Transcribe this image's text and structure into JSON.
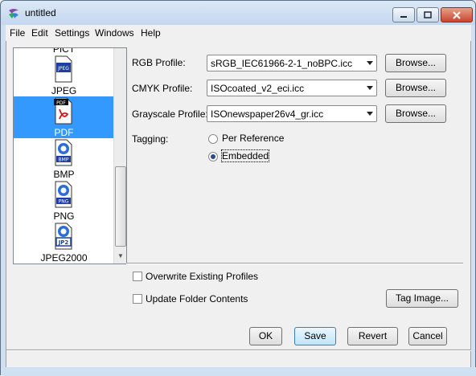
{
  "window": {
    "title": "untitled"
  },
  "menubar": {
    "items": [
      "File",
      "Edit",
      "Settings",
      "Windows",
      "Help"
    ]
  },
  "format_list": {
    "partial_top_label": "PICT",
    "items": [
      {
        "label": "JPEG",
        "icon_text": "JPEG",
        "icon": "jpeg-file-icon",
        "selected": false
      },
      {
        "label": "PDF",
        "icon_text": "PDF",
        "icon": "pdf-file-icon",
        "selected": true
      },
      {
        "label": "BMP",
        "icon_text": "BMP",
        "icon": "bmp-file-icon",
        "selected": false
      },
      {
        "label": "PNG",
        "icon_text": "PNG",
        "icon": "png-file-icon",
        "selected": false
      },
      {
        "label": "JPEG2000",
        "icon_text": "JP2",
        "icon": "jp2-file-icon",
        "selected": false
      }
    ]
  },
  "profiles": {
    "rgb_label": "RGB Profile:",
    "rgb_value": "sRGB_IEC61966-2-1_noBPC.icc",
    "cmyk_label": "CMYK Profile:",
    "cmyk_value": "ISOcoated_v2_eci.icc",
    "gray_label": "Grayscale Profile:",
    "gray_value": "ISOnewspaper26v4_gr.icc",
    "browse_label": "Browse..."
  },
  "tagging": {
    "label": "Tagging:",
    "options": [
      "Per Reference",
      "Embedded"
    ],
    "selected": "Embedded"
  },
  "options": {
    "overwrite_label": "Overwrite Existing Profiles",
    "overwrite_checked": false,
    "update_folder_label": "Update Folder Contents",
    "update_folder_checked": false,
    "tag_image_label": "Tag Image..."
  },
  "footer": {
    "ok_label": "OK",
    "save_label": "Save",
    "revert_label": "Revert",
    "cancel_label": "Cancel"
  },
  "colors": {
    "selection": "#3399ff",
    "title_bar": "#c4d7ee",
    "close_button": "#c8452c",
    "default_button": "#bee6fd"
  }
}
